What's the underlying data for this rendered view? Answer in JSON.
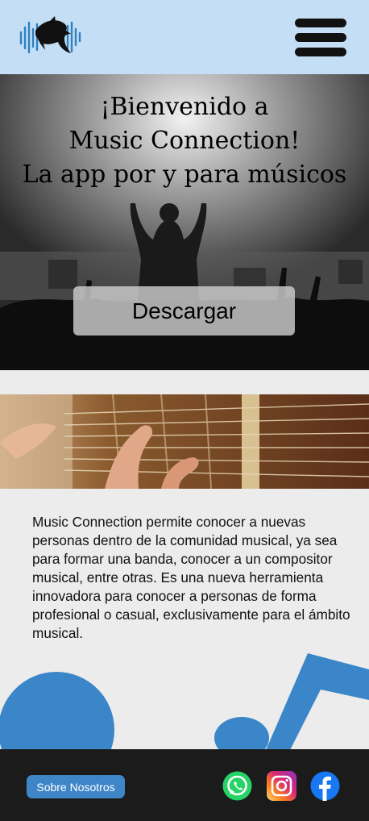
{
  "header": {
    "logo": "dolphin-soundwave-logo",
    "menu_icon": "hamburger-menu-icon",
    "background": "#c4dff5"
  },
  "hero": {
    "title_lines": [
      "¡Bienvenido a",
      "Music Connection!",
      "La app por y para músicos"
    ],
    "download_label": "Descargar",
    "image": "concert-crowd-photo"
  },
  "guitar_image": "acoustic-guitar-photo",
  "description": "Music Connection permite conocer a nuevas personas  dentro de la comunidad musical, ya sea para formar una banda, conocer a un compositor musical, entre otras. Es una nueva herramienta innovadora para conocer a personas de forma profesional o casual, exclusivamente para el ámbito musical.",
  "decor": {
    "shapes": [
      "blue-circle",
      "music-note"
    ],
    "color": "#3a86c8"
  },
  "footer": {
    "about_label": "Sobre Nosotros",
    "about_color": "#3f86c9",
    "social": [
      "whatsapp-icon",
      "instagram-icon",
      "facebook-icon"
    ],
    "background": "#1b1b1b"
  }
}
